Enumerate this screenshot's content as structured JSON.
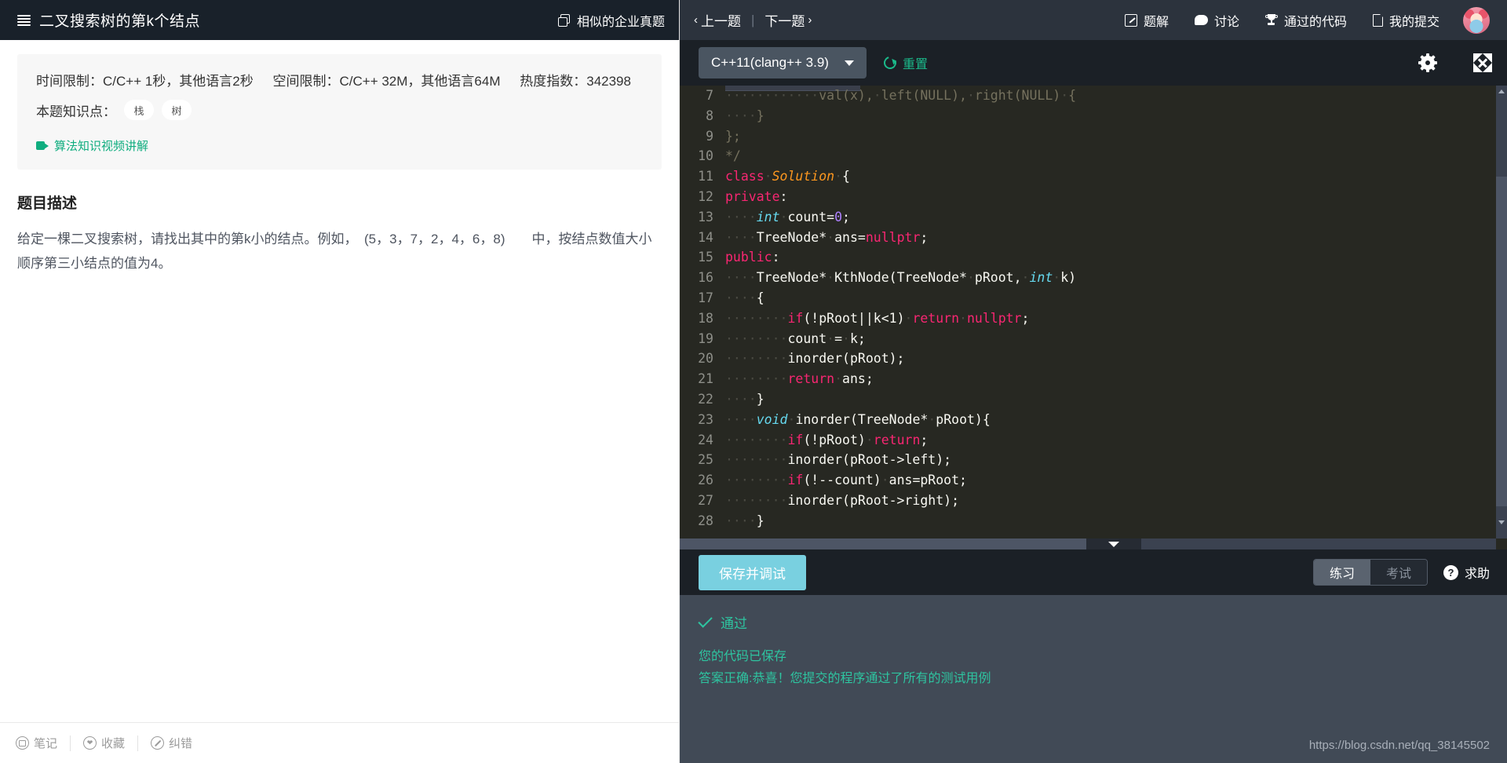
{
  "left_header": {
    "menu_icon": "hamburger-menu-icon",
    "title": "二叉搜索树的第k个结点",
    "similar_icon": "copy-stack-icon",
    "similar_label": "相似的企业真题"
  },
  "info_card": {
    "time_limit": "时间限制：C/C++ 1秒，其他语言2秒",
    "space_limit": "空间限制：C/C++ 32M，其他语言64M",
    "heat_index": "热度指数：342398",
    "knowledge_label": "本题知识点：",
    "knowledge_points": [
      "栈",
      "树"
    ],
    "video_icon": "video-camera-icon",
    "video_label": "算法知识视频讲解"
  },
  "description": {
    "title": "题目描述",
    "body": "给定一棵二叉搜索树，请找出其中的第k小的结点。例如，　(5，3，7，2，4，6，8)　　中，按结点数值大小顺序第三小结点的值为4。"
  },
  "left_footer": {
    "items": [
      {
        "icon": "book-icon",
        "label": "笔记"
      },
      {
        "icon": "heart-icon",
        "label": "收藏"
      },
      {
        "icon": "pencil-icon",
        "label": "纠错"
      }
    ]
  },
  "right_header": {
    "prev_label": "上一题",
    "next_label": "下一题",
    "separator": "|",
    "actions": [
      {
        "icon": "edit-square-icon",
        "label": "题解"
      },
      {
        "icon": "speech-bubble-icon",
        "label": "讨论"
      },
      {
        "icon": "trophy-icon",
        "label": "通过的代码"
      },
      {
        "icon": "document-icon",
        "label": "我的提交"
      }
    ],
    "avatar": "user-avatar"
  },
  "editor_toolbar": {
    "language": "C++11(clang++ 3.9)",
    "caret_icon": "chevron-down-icon",
    "reset_icon": "refresh-icon",
    "reset_label": "重置",
    "settings_icon": "gear-icon",
    "fullscreen_icon": "expand-arrows-icon"
  },
  "code": {
    "first_line_number": 7,
    "lines": [
      {
        "n": 7,
        "tokens": [
          {
            "t": "············",
            "c": "dot"
          },
          {
            "t": "val(x),",
            "c": "com"
          },
          {
            "t": "·",
            "c": "dot"
          },
          {
            "t": "left(NULL),",
            "c": "com"
          },
          {
            "t": "·",
            "c": "dot"
          },
          {
            "t": "right(NULL)",
            "c": "com"
          },
          {
            "t": "·",
            "c": "dot"
          },
          {
            "t": "{",
            "c": "com"
          }
        ]
      },
      {
        "n": 8,
        "tokens": [
          {
            "t": "····",
            "c": "dot"
          },
          {
            "t": "}",
            "c": "com"
          }
        ]
      },
      {
        "n": 9,
        "tokens": [
          {
            "t": "};",
            "c": "com"
          }
        ]
      },
      {
        "n": 10,
        "tokens": [
          {
            "t": "*/",
            "c": "com"
          }
        ]
      },
      {
        "n": 11,
        "tokens": [
          {
            "t": "class",
            "c": "key"
          },
          {
            "t": "·",
            "c": "dot"
          },
          {
            "t": "Solution",
            "c": "cls"
          },
          {
            "t": "·",
            "c": "dot"
          },
          {
            "t": "{",
            "c": "plain"
          }
        ]
      },
      {
        "n": 12,
        "tokens": [
          {
            "t": "private",
            "c": "key"
          },
          {
            "t": ":",
            "c": "plain"
          }
        ]
      },
      {
        "n": 13,
        "tokens": [
          {
            "t": "····",
            "c": "dot"
          },
          {
            "t": "int",
            "c": "type"
          },
          {
            "t": "·",
            "c": "dot"
          },
          {
            "t": "count=",
            "c": "plain"
          },
          {
            "t": "0",
            "c": "num"
          },
          {
            "t": ";",
            "c": "plain"
          }
        ]
      },
      {
        "n": 14,
        "tokens": [
          {
            "t": "····",
            "c": "dot"
          },
          {
            "t": "TreeNode*",
            "c": "plain"
          },
          {
            "t": "·",
            "c": "dot"
          },
          {
            "t": "ans=",
            "c": "plain"
          },
          {
            "t": "nullptr",
            "c": "key"
          },
          {
            "t": ";",
            "c": "plain"
          }
        ]
      },
      {
        "n": 15,
        "tokens": [
          {
            "t": "public",
            "c": "key"
          },
          {
            "t": ":",
            "c": "plain"
          }
        ]
      },
      {
        "n": 16,
        "tokens": [
          {
            "t": "····",
            "c": "dot"
          },
          {
            "t": "TreeNode*",
            "c": "plain"
          },
          {
            "t": "·",
            "c": "dot"
          },
          {
            "t": "KthNode(TreeNode*",
            "c": "plain"
          },
          {
            "t": "·",
            "c": "dot"
          },
          {
            "t": "pRoot,",
            "c": "plain"
          },
          {
            "t": "·",
            "c": "dot"
          },
          {
            "t": "int",
            "c": "type"
          },
          {
            "t": "·",
            "c": "dot"
          },
          {
            "t": "k)",
            "c": "plain"
          }
        ]
      },
      {
        "n": 17,
        "tokens": [
          {
            "t": "····",
            "c": "dot"
          },
          {
            "t": "{",
            "c": "plain"
          }
        ]
      },
      {
        "n": 18,
        "tokens": [
          {
            "t": "········",
            "c": "dot"
          },
          {
            "t": "if",
            "c": "key"
          },
          {
            "t": "(!pRoot||k<1)",
            "c": "plain"
          },
          {
            "t": "·",
            "c": "dot"
          },
          {
            "t": "return",
            "c": "key"
          },
          {
            "t": "·",
            "c": "dot"
          },
          {
            "t": "nullptr",
            "c": "key"
          },
          {
            "t": ";",
            "c": "plain"
          }
        ]
      },
      {
        "n": 19,
        "tokens": [
          {
            "t": "········",
            "c": "dot"
          },
          {
            "t": "count",
            "c": "plain"
          },
          {
            "t": "·",
            "c": "dot"
          },
          {
            "t": "=",
            "c": "plain"
          },
          {
            "t": "·",
            "c": "dot"
          },
          {
            "t": "k;",
            "c": "plain"
          }
        ]
      },
      {
        "n": 20,
        "tokens": [
          {
            "t": "········",
            "c": "dot"
          },
          {
            "t": "inorder(pRoot);",
            "c": "plain"
          }
        ]
      },
      {
        "n": 21,
        "tokens": [
          {
            "t": "········",
            "c": "dot"
          },
          {
            "t": "return",
            "c": "key"
          },
          {
            "t": "·",
            "c": "dot"
          },
          {
            "t": "ans;",
            "c": "plain"
          }
        ]
      },
      {
        "n": 22,
        "tokens": [
          {
            "t": "····",
            "c": "dot"
          },
          {
            "t": "}",
            "c": "plain"
          }
        ]
      },
      {
        "n": 23,
        "tokens": [
          {
            "t": "····",
            "c": "dot"
          },
          {
            "t": "void",
            "c": "type"
          },
          {
            "t": "·",
            "c": "dot"
          },
          {
            "t": "inorder(TreeNode*",
            "c": "plain"
          },
          {
            "t": "·",
            "c": "dot"
          },
          {
            "t": "pRoot){",
            "c": "plain"
          }
        ]
      },
      {
        "n": 24,
        "tokens": [
          {
            "t": "········",
            "c": "dot"
          },
          {
            "t": "if",
            "c": "key"
          },
          {
            "t": "(!pRoot)",
            "c": "plain"
          },
          {
            "t": "·",
            "c": "dot"
          },
          {
            "t": "return",
            "c": "key"
          },
          {
            "t": ";",
            "c": "plain"
          }
        ]
      },
      {
        "n": 25,
        "tokens": [
          {
            "t": "········",
            "c": "dot"
          },
          {
            "t": "inorder(pRoot->left);",
            "c": "plain"
          }
        ]
      },
      {
        "n": 26,
        "tokens": [
          {
            "t": "········",
            "c": "dot"
          },
          {
            "t": "if",
            "c": "key"
          },
          {
            "t": "(!--count)",
            "c": "plain"
          },
          {
            "t": "·",
            "c": "dot"
          },
          {
            "t": "ans=pRoot;",
            "c": "plain"
          }
        ]
      },
      {
        "n": 27,
        "tokens": [
          {
            "t": "········",
            "c": "dot"
          },
          {
            "t": "inorder(pRoot->right);",
            "c": "plain"
          }
        ]
      },
      {
        "n": 28,
        "tokens": [
          {
            "t": "····",
            "c": "dot"
          },
          {
            "t": "}",
            "c": "plain"
          }
        ]
      }
    ],
    "collapse_icon": "chevron-down-icon"
  },
  "action_bar": {
    "save_debug_label": "保存并调试",
    "modes": [
      {
        "label": "练习",
        "active": true
      },
      {
        "label": "考试",
        "active": false
      }
    ],
    "help_icon": "question-mark-icon",
    "help_label": "求助"
  },
  "result": {
    "check_icon": "check-mark-icon",
    "status": "通过",
    "lines": [
      "您的代码已保存",
      "答案正确:恭喜！您提交的程序通过了所有的测试用例"
    ]
  },
  "watermark": "https://blog.csdn.net/qq_38145502",
  "colors": {
    "header_dark": "#19212a",
    "header_slate": "#2c333d",
    "editor_bg": "#272822",
    "accent_green": "#1bb98a",
    "result_bg": "#414a56",
    "result_green": "#2ec4a0",
    "save_button": "#79d0e0",
    "lang_select": "#4a5561"
  }
}
